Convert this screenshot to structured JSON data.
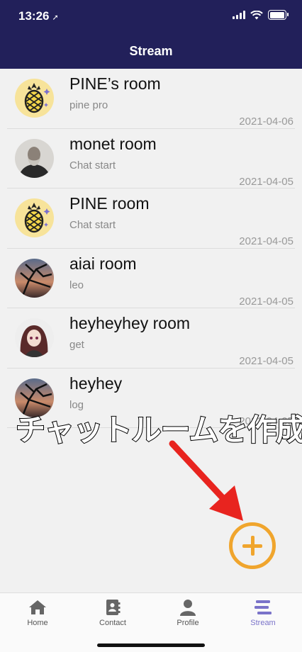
{
  "status": {
    "time": "13:26"
  },
  "nav": {
    "title": "Stream"
  },
  "rooms": [
    {
      "name": "PINE’s room",
      "sub": "pine pro",
      "date": "2021-04-06",
      "avatar": "pineapple"
    },
    {
      "name": "monet room",
      "sub": "Chat start",
      "date": "2021-04-05",
      "avatar": "portrait"
    },
    {
      "name": "PINE room",
      "sub": "Chat start",
      "date": "2021-04-05",
      "avatar": "pineapple"
    },
    {
      "name": "aiai room",
      "sub": "leo",
      "date": "2021-04-05",
      "avatar": "sunset-tree"
    },
    {
      "name": "heyheyhey room",
      "sub": "get",
      "date": "2021-04-05",
      "avatar": "anime"
    },
    {
      "name": "heyhey",
      "sub": "log",
      "date": "2021-04-05",
      "avatar": "sunset-tree"
    }
  ],
  "overlay": {
    "text": "チャットルームを作成"
  },
  "tabs": [
    {
      "label": "Home",
      "icon": "home-icon",
      "active": false
    },
    {
      "label": "Contact",
      "icon": "contact-book-icon",
      "active": false
    },
    {
      "label": "Profile",
      "icon": "person-icon",
      "active": false
    },
    {
      "label": "Stream",
      "icon": "stream-lines-icon",
      "active": true
    }
  ],
  "colors": {
    "header": "#22205a",
    "fab": "#f0a52d",
    "arrow": "#e8241f",
    "active_tab": "#7a73c9"
  }
}
